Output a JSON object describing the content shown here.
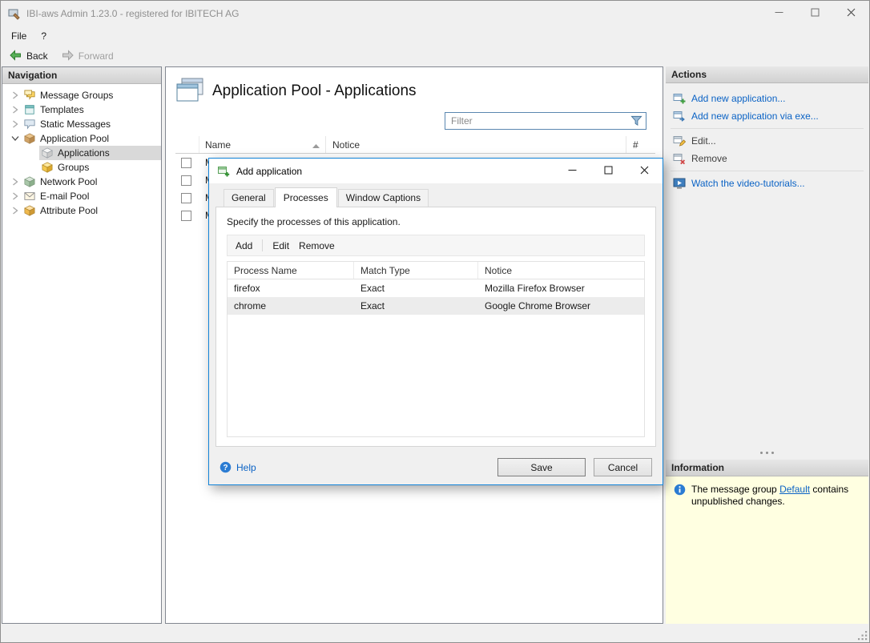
{
  "colors": {
    "link": "#0b63c5",
    "dialog_border": "#1283d8",
    "info_bg": "#ffffe1",
    "selection": "#d9d9d9",
    "row_selected": "#ececec"
  },
  "window": {
    "title": "IBI-aws Admin 1.23.0 - registered for IBITECH AG"
  },
  "menubar": {
    "file": "File",
    "help": "?"
  },
  "toolbar": {
    "back": "Back",
    "forward": "Forward"
  },
  "navigation": {
    "header": "Navigation",
    "items": [
      {
        "label": "Message Groups"
      },
      {
        "label": "Templates"
      },
      {
        "label": "Static Messages"
      },
      {
        "label": "Application Pool"
      },
      {
        "label": "Applications"
      },
      {
        "label": "Groups"
      },
      {
        "label": "Network Pool"
      },
      {
        "label": "E-mail Pool"
      },
      {
        "label": "Attribute Pool"
      }
    ]
  },
  "main": {
    "title": "Application Pool - Applications",
    "filter_placeholder": "Filter",
    "table": {
      "col_name": "Name",
      "col_notice": "Notice",
      "col_count": "#",
      "rows": [
        {
          "name": "M"
        },
        {
          "name": "M"
        },
        {
          "name": "M"
        },
        {
          "name": "M"
        }
      ]
    }
  },
  "dialog": {
    "title": "Add application",
    "tabs": {
      "general": "General",
      "processes": "Processes",
      "captions": "Window Captions"
    },
    "description": "Specify the processes of this application.",
    "toolbar": {
      "add": "Add",
      "edit": "Edit",
      "remove": "Remove"
    },
    "table": {
      "col_process": "Process Name",
      "col_match": "Match Type",
      "col_notice": "Notice",
      "rows": [
        {
          "process": "firefox",
          "match": "Exact",
          "notice": "Mozilla Firefox Browser"
        },
        {
          "process": "chrome",
          "match": "Exact",
          "notice": "Google Chrome Browser"
        }
      ]
    },
    "help": "Help",
    "save": "Save",
    "cancel": "Cancel"
  },
  "actions": {
    "header": "Actions",
    "add_new": "Add new application...",
    "add_new_exe": "Add new application via exe...",
    "edit": "Edit...",
    "remove": "Remove",
    "watch": "Watch the video-tutorials..."
  },
  "information": {
    "header": "Information",
    "text_before": "The message group ",
    "link": "Default",
    "text_after": " contains unpublished changes."
  }
}
